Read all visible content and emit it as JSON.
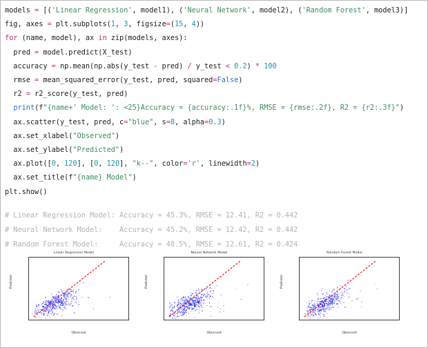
{
  "code": {
    "lines": [
      [
        {
          "t": "models ",
          "c": "plain"
        },
        {
          "t": "=",
          "c": "op"
        },
        {
          "t": " [(",
          "c": "plain"
        },
        {
          "t": "'Linear Regression'",
          "c": "str"
        },
        {
          "t": ", model1), (",
          "c": "plain"
        },
        {
          "t": "'Neural Network'",
          "c": "str"
        },
        {
          "t": ", model2), (",
          "c": "plain"
        },
        {
          "t": "'Random Forest'",
          "c": "str"
        },
        {
          "t": ", model3)]",
          "c": "plain"
        }
      ],
      [
        {
          "t": "fig, axes ",
          "c": "plain"
        },
        {
          "t": "=",
          "c": "op"
        },
        {
          "t": " plt.subplots(",
          "c": "plain"
        },
        {
          "t": "1",
          "c": "num"
        },
        {
          "t": ", ",
          "c": "plain"
        },
        {
          "t": "3",
          "c": "num"
        },
        {
          "t": ", figsize",
          "c": "plain"
        },
        {
          "t": "=",
          "c": "op"
        },
        {
          "t": "(",
          "c": "plain"
        },
        {
          "t": "15",
          "c": "num"
        },
        {
          "t": ", ",
          "c": "plain"
        },
        {
          "t": "4",
          "c": "num"
        },
        {
          "t": "))",
          "c": "plain"
        }
      ],
      [
        {
          "t": "for",
          "c": "kw"
        },
        {
          "t": " (name, model), ax ",
          "c": "plain"
        },
        {
          "t": "in",
          "c": "kw"
        },
        {
          "t": " zip(models, axes):",
          "c": "plain"
        }
      ],
      [
        {
          "t": "  pred ",
          "c": "plain"
        },
        {
          "t": "=",
          "c": "op"
        },
        {
          "t": " model.predict(X_test)",
          "c": "plain"
        }
      ],
      [
        {
          "t": "  accuracy ",
          "c": "plain"
        },
        {
          "t": "=",
          "c": "op"
        },
        {
          "t": " np.mean(np.abs(y_test ",
          "c": "plain"
        },
        {
          "t": "-",
          "c": "op"
        },
        {
          "t": " pred) ",
          "c": "plain"
        },
        {
          "t": "/",
          "c": "op"
        },
        {
          "t": " y_test ",
          "c": "plain"
        },
        {
          "t": "<",
          "c": "op"
        },
        {
          "t": " ",
          "c": "plain"
        },
        {
          "t": "0.2",
          "c": "num"
        },
        {
          "t": ") ",
          "c": "plain"
        },
        {
          "t": "*",
          "c": "op"
        },
        {
          "t": " ",
          "c": "plain"
        },
        {
          "t": "100",
          "c": "num"
        }
      ],
      [
        {
          "t": "  rmse ",
          "c": "plain"
        },
        {
          "t": "=",
          "c": "op"
        },
        {
          "t": " mean_squared_error(y_test, pred, squared",
          "c": "plain"
        },
        {
          "t": "=",
          "c": "op"
        },
        {
          "t": "False",
          "c": "blue"
        },
        {
          "t": ")",
          "c": "plain"
        }
      ],
      [
        {
          "t": "  r2 ",
          "c": "plain"
        },
        {
          "t": "=",
          "c": "op"
        },
        {
          "t": " r2_score(y_test, pred)",
          "c": "plain"
        }
      ],
      [
        {
          "t": "  ",
          "c": "plain"
        },
        {
          "t": "print",
          "c": "blue"
        },
        {
          "t": "(f",
          "c": "plain"
        },
        {
          "t": "\"{name+' Model: ': <25}Accuracy = {accuracy:.1f}%, RMSE = {rmse:.2f}, R2 = {r2:.3f}\"",
          "c": "str"
        },
        {
          "t": ")",
          "c": "plain"
        }
      ],
      [
        {
          "t": "  ax.scatter(y_test, pred, c",
          "c": "plain"
        },
        {
          "t": "=",
          "c": "op"
        },
        {
          "t": "\"blue\"",
          "c": "str"
        },
        {
          "t": ", s",
          "c": "plain"
        },
        {
          "t": "=",
          "c": "op"
        },
        {
          "t": "8",
          "c": "num"
        },
        {
          "t": ", alpha",
          "c": "plain"
        },
        {
          "t": "=",
          "c": "op"
        },
        {
          "t": "0.3",
          "c": "num"
        },
        {
          "t": ")",
          "c": "plain"
        }
      ],
      [
        {
          "t": "  ax.set_xlabel(",
          "c": "plain"
        },
        {
          "t": "\"Observed\"",
          "c": "str"
        },
        {
          "t": ")",
          "c": "plain"
        }
      ],
      [
        {
          "t": "  ax.set_ylabel(",
          "c": "plain"
        },
        {
          "t": "\"Predicted\"",
          "c": "str"
        },
        {
          "t": ")",
          "c": "plain"
        }
      ],
      [
        {
          "t": "  ax.plot([",
          "c": "plain"
        },
        {
          "t": "0",
          "c": "num"
        },
        {
          "t": ", ",
          "c": "plain"
        },
        {
          "t": "120",
          "c": "num"
        },
        {
          "t": "], [",
          "c": "plain"
        },
        {
          "t": "0",
          "c": "num"
        },
        {
          "t": ", ",
          "c": "plain"
        },
        {
          "t": "120",
          "c": "num"
        },
        {
          "t": "], ",
          "c": "plain"
        },
        {
          "t": "\"k--\"",
          "c": "str"
        },
        {
          "t": ", color",
          "c": "plain"
        },
        {
          "t": "=",
          "c": "op"
        },
        {
          "t": "'r'",
          "c": "str"
        },
        {
          "t": ", linewidth",
          "c": "plain"
        },
        {
          "t": "=",
          "c": "op"
        },
        {
          "t": "2",
          "c": "num"
        },
        {
          "t": ")",
          "c": "plain"
        }
      ],
      [
        {
          "t": "  ax.set_title(f",
          "c": "plain"
        },
        {
          "t": "\"{name} Model\"",
          "c": "str"
        },
        {
          "t": ")",
          "c": "plain"
        }
      ],
      [
        {
          "t": "plt.show()",
          "c": "plain"
        }
      ]
    ],
    "comment_lines": [
      "# Linear Regression Model: Accuracy = 45.3%, RMSE = 12.41, R2 = 0.442",
      "# Neural Network Model:    Accuracy = 45.2%, RMSE = 12.42, R2 = 0.442",
      "# Random Forest Model:     Accuracy = 48.5%, RMSE = 12.61, R2 = 0.424"
    ]
  },
  "results": [
    {
      "model": "Linear Regression Model",
      "accuracy": "45.3%",
      "rmse": "12.41",
      "r2": "0.442"
    },
    {
      "model": "Neural Network Model",
      "accuracy": "45.2%",
      "rmse": "12.42",
      "r2": "0.442"
    },
    {
      "model": "Random Forest Model",
      "accuracy": "48.5%",
      "rmse": "12.61",
      "r2": "0.424"
    }
  ],
  "colors": {
    "string": "#3f8f58",
    "keyword": "#c42b7b",
    "number": "#1597b0",
    "builtin": "#2a6fd6",
    "comment": "#b4b4b4",
    "scatter": "#1111ee",
    "refline": "#ee1111",
    "border": "#b9b9b9"
  },
  "chart_data": [
    {
      "type": "scatter",
      "title": "Linear Regression Model",
      "xlabel": "Observed",
      "ylabel": "Predicted",
      "xlim": [
        -8,
        160
      ],
      "ylim": [
        -6,
        128
      ],
      "xticks": [
        0,
        25,
        50,
        75,
        100,
        125,
        150
      ],
      "yticks": [
        0,
        20,
        40,
        60,
        80,
        100,
        120
      ],
      "grid": false,
      "legend": "none",
      "reference_line": {
        "x": [
          0,
          120
        ],
        "y": [
          0,
          120
        ],
        "color": "#ee1111",
        "style": "dashed",
        "linewidth": 2
      },
      "marker": {
        "color": "#1111ee",
        "size": 8,
        "alpha": 0.3
      },
      "stats": {
        "accuracy": 45.3,
        "rmse": 12.41,
        "r2": 0.442
      },
      "point_cloud": {
        "n": 520,
        "center": [
          32,
          31
        ],
        "spread": [
          18,
          14
        ],
        "correlation": 0.72
      }
    },
    {
      "type": "scatter",
      "title": "Neural Network Model",
      "xlabel": "Observed",
      "ylabel": "Predicted",
      "xlim": [
        -8,
        160
      ],
      "ylim": [
        -6,
        128
      ],
      "xticks": [
        0,
        25,
        50,
        75,
        100,
        125,
        150
      ],
      "yticks": [
        0,
        20,
        40,
        60,
        80,
        100,
        120
      ],
      "grid": false,
      "legend": "none",
      "reference_line": {
        "x": [
          0,
          120
        ],
        "y": [
          0,
          120
        ],
        "color": "#ee1111",
        "style": "dashed",
        "linewidth": 2
      },
      "marker": {
        "color": "#1111ee",
        "size": 8,
        "alpha": 0.3
      },
      "stats": {
        "accuracy": 45.2,
        "rmse": 12.42,
        "r2": 0.442
      },
      "point_cloud": {
        "n": 520,
        "center": [
          32,
          31
        ],
        "spread": [
          18,
          14
        ],
        "correlation": 0.72
      }
    },
    {
      "type": "scatter",
      "title": "Random Forest Model",
      "xlabel": "Observed",
      "ylabel": "Predicted",
      "xlim": [
        -8,
        160
      ],
      "ylim": [
        -6,
        128
      ],
      "xticks": [
        0,
        25,
        50,
        75,
        100,
        125,
        150
      ],
      "yticks": [
        0,
        20,
        40,
        60,
        80,
        100,
        120
      ],
      "grid": false,
      "legend": "none",
      "reference_line": {
        "x": [
          0,
          120
        ],
        "y": [
          0,
          120
        ],
        "color": "#ee1111",
        "style": "dashed",
        "linewidth": 2
      },
      "marker": {
        "color": "#1111ee",
        "size": 8,
        "alpha": 0.3
      },
      "stats": {
        "accuracy": 48.5,
        "rmse": 12.61,
        "r2": 0.424
      },
      "point_cloud": {
        "n": 520,
        "center": [
          31,
          31
        ],
        "spread": [
          17,
          15
        ],
        "correlation": 0.69
      }
    }
  ]
}
